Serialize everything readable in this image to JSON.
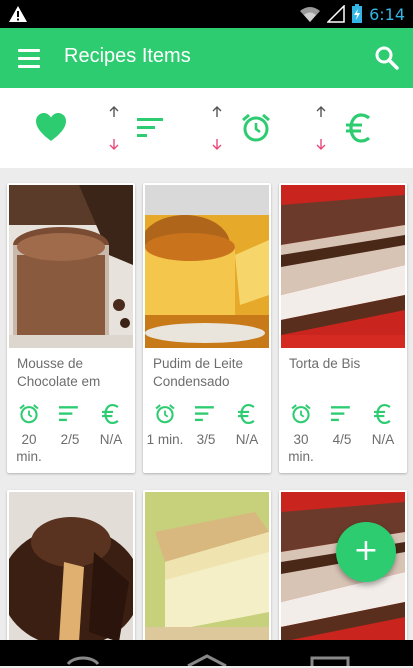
{
  "status_bar": {
    "time": "6:14",
    "icons": [
      "warning-icon",
      "wifi-icon",
      "signal-icon",
      "battery-icon"
    ]
  },
  "app_bar": {
    "title": "Recipes Items",
    "menu_icon": "menu-icon",
    "search_icon": "search-icon"
  },
  "sort_bar": {
    "items": [
      {
        "icon": "heart-icon"
      },
      {
        "icon": "difficulty-icon",
        "arrows": [
          "arrow-up-icon",
          "arrow-down-icon"
        ]
      },
      {
        "icon": "alarm-clock-icon",
        "arrows": [
          "arrow-up-icon",
          "arrow-down-icon"
        ]
      },
      {
        "icon": "euro-icon",
        "arrows": [
          "arrow-up-icon",
          "arrow-down-icon"
        ]
      }
    ]
  },
  "recipes": [
    {
      "name": "Mousse de Chocolate em",
      "time": "20 min.",
      "difficulty": "2/5",
      "price": "N/A"
    },
    {
      "name": "Pudim de Leite Condensado",
      "time": "1 min.",
      "difficulty": "3/5",
      "price": "N/A"
    },
    {
      "name": "Torta de Bis",
      "time": "30 min.",
      "difficulty": "4/5",
      "price": "N/A"
    }
  ],
  "fab": {
    "label": "+"
  },
  "colors": {
    "primary": "#2ecc71",
    "accent_down": "#e84a7a",
    "status_time": "#33b5e5"
  }
}
